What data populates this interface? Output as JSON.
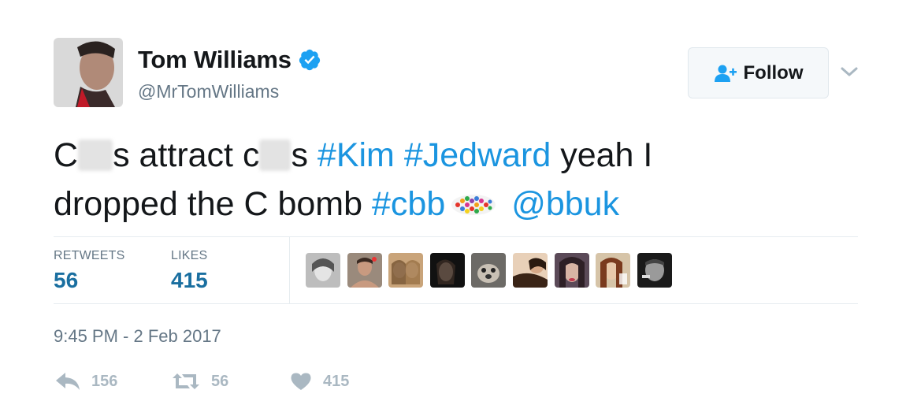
{
  "user": {
    "display_name": "Tom Williams",
    "handle": "@MrTomWilliams",
    "verified": true
  },
  "follow": {
    "label": "Follow",
    "icon": "add-user-icon"
  },
  "tweet": {
    "line1_a": "C",
    "line1_b": "s attract c",
    "line1_c": "s ",
    "hashtag_kim": "#Kim",
    "hashtag_jedward": "#Jedward",
    "line1_tail": " yeah I",
    "line2_a": "dropped the C bomb ",
    "hashtag_cbb": "#cbb",
    "mention": "@bbuk"
  },
  "stats": {
    "retweets_label": "RETWEETS",
    "retweets_value": "56",
    "likes_label": "LIKES",
    "likes_value": "415"
  },
  "timestamp": "9:45 PM - 2 Feb 2017",
  "actions": {
    "reply_count": "156",
    "retweet_count": "56",
    "like_count": "415"
  },
  "colors": {
    "link": "#1b95e0",
    "stat_value": "#1a6fa0",
    "muted": "#657786",
    "action_gray": "#aab8c2",
    "verified_blue": "#1da1f2"
  }
}
